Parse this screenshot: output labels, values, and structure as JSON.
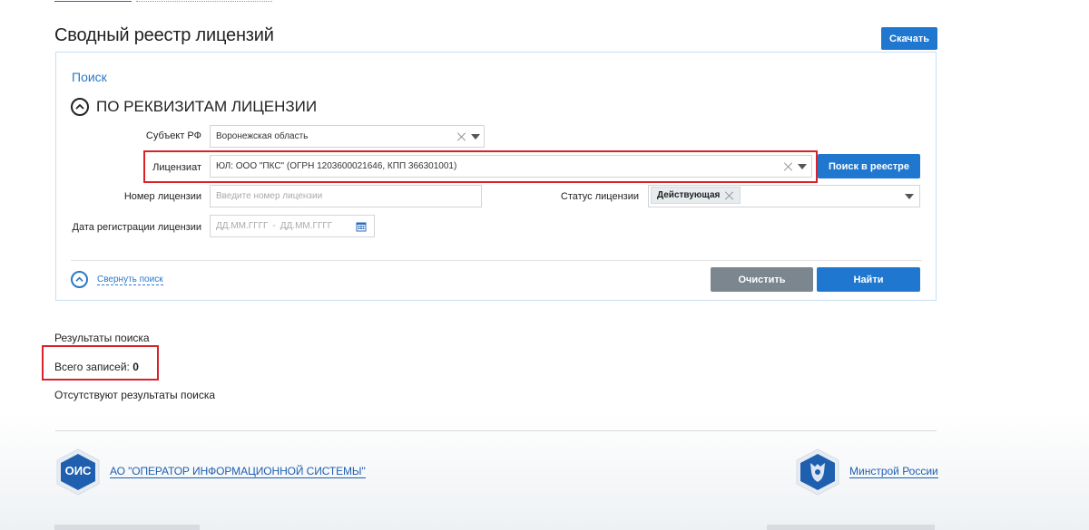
{
  "page": {
    "title": "Сводный реестр лицензий",
    "download_label": "Скачать"
  },
  "search": {
    "panel_title": "Поиск",
    "section_title": "ПО РЕКВИЗИТАМ ЛИЦЕНЗИИ",
    "subject_label": "Субъект РФ",
    "subject_value": "Воронежская область",
    "licensee_label": "Лицензиат",
    "licensee_value": "ЮЛ: ООО \"ПКС\" (ОГРН 1203600021646, КПП 366301001)",
    "search_registry_label": "Поиск в реестре",
    "license_number_label": "Номер лицензии",
    "license_number_placeholder": "Введите номер лицензии",
    "license_status_label": "Статус лицензии",
    "license_status_tag": "Действующая",
    "reg_date_label": "Дата регистрации лицензии",
    "date_from_placeholder": "ДД.ММ.ГГГГ",
    "date_sep": "-",
    "date_to_placeholder": "ДД.ММ.ГГГГ",
    "collapse_label": "Свернуть поиск",
    "clear_label": "Очистить",
    "find_label": "Найти"
  },
  "results": {
    "title": "Результаты поиска",
    "count_label": "Всего записей:",
    "count_value": "0",
    "empty_text": "Отсутствуют результаты поиска"
  },
  "footer": {
    "ois_logo_text": "ОИС",
    "ois_link": "АО \"ОПЕРАТОР ИНФОРМАЦИОННОЙ СИСТЕМЫ\"",
    "minstroy_link": "Минстрой России"
  },
  "colors": {
    "accent": "#1f77d0",
    "highlight": "#d8232a",
    "gray_button": "#7b868e"
  }
}
